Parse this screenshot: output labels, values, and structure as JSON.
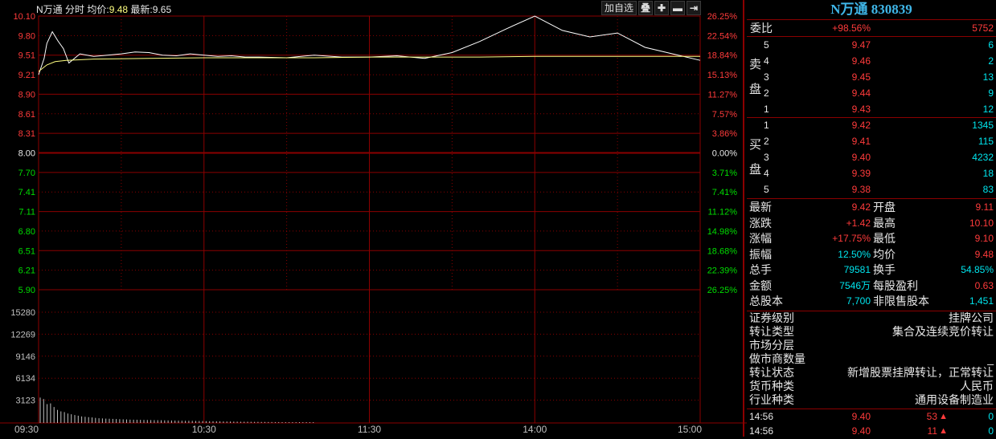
{
  "header": {
    "name": "N万通",
    "mode": "分时",
    "avg_label": "均价:",
    "avg_value": "9.48",
    "last_label": "最新:",
    "last_value": "9.65"
  },
  "toolbar": {
    "add_watch": "加自选",
    "overlay": "叠",
    "zoom_in": "✚",
    "zoom_out": "▬",
    "expand": "⇥"
  },
  "colors": {
    "up": "#ff3b3b",
    "down": "#00dd00",
    "grid": "#8b0000",
    "price_line": "#ffffff",
    "avg_line": "#ffff80",
    "volume": "#c0c0c0",
    "accent": "#00e5ee",
    "title": "#3fb6e8"
  },
  "chart_data": {
    "type": "line",
    "price_axis_left": [
      "10.10",
      "9.80",
      "9.51",
      "9.21",
      "8.90",
      "8.61",
      "8.31",
      "8.00",
      "7.70",
      "7.41",
      "7.11",
      "6.80",
      "6.51",
      "6.21",
      "5.90"
    ],
    "pct_axis_right": [
      "26.25%",
      "22.54%",
      "18.84%",
      "15.13%",
      "11.27%",
      "7.57%",
      "3.86%",
      "0.00%",
      "3.71%",
      "7.41%",
      "11.12%",
      "14.98%",
      "18.68%",
      "22.39%",
      "26.25%"
    ],
    "volume_axis": [
      "15280",
      "12269",
      "9146",
      "6134",
      "3123"
    ],
    "time_axis": [
      "09:30",
      "10:30",
      "11:30",
      "14:00",
      "15:00"
    ],
    "ylim": [
      5.9,
      10.1
    ],
    "prev_close": 8.0,
    "series": [
      {
        "time_index": [
          0,
          2,
          3,
          5,
          7,
          9,
          11,
          15,
          20,
          25,
          30,
          35,
          40,
          45,
          50,
          55,
          60,
          65,
          70,
          75,
          80,
          90,
          100,
          110,
          120,
          130,
          140,
          150,
          160,
          170,
          180,
          190,
          200,
          210,
          220,
          230,
          240
        ],
        "values": [
          9.2,
          9.45,
          9.68,
          9.86,
          9.72,
          9.6,
          9.38,
          9.52,
          9.48,
          9.5,
          9.52,
          9.55,
          9.54,
          9.5,
          9.49,
          9.52,
          9.5,
          9.48,
          9.49,
          9.47,
          9.47,
          9.46,
          9.5,
          9.47,
          9.47,
          9.49,
          9.45,
          9.54,
          9.71,
          9.91,
          10.1,
          9.88,
          9.78,
          9.84,
          9.62,
          9.52,
          9.42
        ]
      },
      {
        "time_index": [
          0,
          3,
          6,
          10,
          20,
          40,
          60,
          80,
          100,
          120,
          140,
          160,
          180,
          200,
          220,
          240
        ],
        "values": [
          9.25,
          9.35,
          9.4,
          9.42,
          9.44,
          9.45,
          9.46,
          9.46,
          9.46,
          9.47,
          9.47,
          9.47,
          9.48,
          9.48,
          9.48,
          9.48
        ]
      }
    ],
    "volume_bars": [
      3500,
      3300,
      2600,
      2700,
      2200,
      1800,
      1600,
      1500,
      1300,
      1200,
      1100,
      1000,
      900,
      850,
      800,
      760,
      700,
      650,
      620,
      600,
      580,
      560,
      540,
      520,
      500,
      480,
      460,
      450,
      440,
      430,
      420,
      410,
      400,
      390,
      380,
      370,
      360,
      350,
      340,
      330,
      320,
      310,
      300,
      300,
      290,
      280,
      270,
      260,
      250,
      240,
      240,
      230,
      220,
      210,
      200,
      200,
      190,
      180,
      170,
      170,
      160,
      160,
      150,
      150,
      140,
      140,
      130,
      130,
      120,
      120,
      110,
      110,
      100,
      100,
      95,
      95,
      90,
      90,
      85,
      85
    ]
  },
  "panel": {
    "title": "N万通  830839",
    "ratio": {
      "label": "委比",
      "pct": "+98.56%",
      "diff": "5752"
    },
    "sell_label": [
      "卖",
      "盘"
    ],
    "buy_label": [
      "买",
      "盘"
    ],
    "sell": [
      {
        "lvl": "5",
        "price": "9.47",
        "vol": "6"
      },
      {
        "lvl": "4",
        "price": "9.46",
        "vol": "2"
      },
      {
        "lvl": "3",
        "price": "9.45",
        "vol": "13"
      },
      {
        "lvl": "2",
        "price": "9.44",
        "vol": "9"
      },
      {
        "lvl": "1",
        "price": "9.43",
        "vol": "12"
      }
    ],
    "buy": [
      {
        "lvl": "1",
        "price": "9.42",
        "vol": "1345"
      },
      {
        "lvl": "2",
        "price": "9.41",
        "vol": "115"
      },
      {
        "lvl": "3",
        "price": "9.40",
        "vol": "4232"
      },
      {
        "lvl": "4",
        "price": "9.39",
        "vol": "18"
      },
      {
        "lvl": "5",
        "price": "9.38",
        "vol": "83"
      }
    ],
    "stats": [
      {
        "l1": "最新",
        "v1": "9.42",
        "c1": "red",
        "l2": "开盘",
        "v2": "9.11",
        "c2": "red"
      },
      {
        "l1": "涨跌",
        "v1": "+1.42",
        "c1": "red",
        "l2": "最高",
        "v2": "10.10",
        "c2": "red"
      },
      {
        "l1": "涨幅",
        "v1": "+17.75%",
        "c1": "red",
        "l2": "最低",
        "v2": "9.10",
        "c2": "red"
      },
      {
        "l1": "振幅",
        "v1": "12.50%",
        "c1": "cyan",
        "l2": "均价",
        "v2": "9.48",
        "c2": "red"
      },
      {
        "l1": "总手",
        "v1": "79581",
        "c1": "cyan",
        "l2": "换手",
        "v2": "54.85%",
        "c2": "cyan"
      },
      {
        "l1": "金额",
        "v1": "7546万",
        "c1": "cyan",
        "l2": "每股盈利",
        "v2": "0.63",
        "c2": "red"
      },
      {
        "l1": "总股本",
        "v1": "7,700",
        "c1": "cyan",
        "l2": "非限售股本",
        "v2": "1,451",
        "c2": "cyan"
      }
    ],
    "info": [
      {
        "label": "证券级别",
        "value": "挂牌公司"
      },
      {
        "label": "转让类型",
        "value": "集合及连续竞价转让"
      },
      {
        "label": "市场分层",
        "value": ""
      },
      {
        "label": "做市商数量",
        "value": "_"
      },
      {
        "label": "转让状态",
        "value": "新增股票挂牌转让，正常转让"
      },
      {
        "label": "货币种类",
        "value": "人民币"
      },
      {
        "label": "行业种类",
        "value": "通用设备制造业"
      }
    ],
    "ticks": [
      {
        "time": "14:56",
        "price": "9.40",
        "vol": "53",
        "arrow": "up-arrow-icon",
        "num": "0"
      },
      {
        "time": "14:56",
        "price": "9.40",
        "vol": "11",
        "arrow": "up-arrow-icon",
        "num": "0"
      }
    ]
  }
}
